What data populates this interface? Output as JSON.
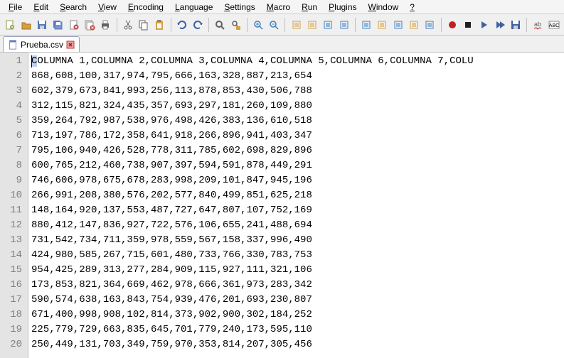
{
  "menu": {
    "items": [
      "File",
      "Edit",
      "Search",
      "View",
      "Encoding",
      "Language",
      "Settings",
      "Macro",
      "Run",
      "Plugins",
      "Window",
      "?"
    ]
  },
  "toolbar": {
    "items": [
      {
        "name": "new-file-icon",
        "color": "#8b9e4a"
      },
      {
        "name": "open-file-icon",
        "color": "#d8a040"
      },
      {
        "name": "save-icon",
        "color": "#5878c0"
      },
      {
        "name": "save-all-icon",
        "color": "#5878c0"
      },
      {
        "name": "close-icon",
        "color": "#c04040"
      },
      {
        "name": "close-all-icon",
        "color": "#c04040"
      },
      {
        "name": "print-icon",
        "color": "#606060"
      },
      {
        "sep": true
      },
      {
        "name": "cut-icon",
        "color": "#606060"
      },
      {
        "name": "copy-icon",
        "color": "#606060"
      },
      {
        "name": "paste-icon",
        "color": "#d8a040"
      },
      {
        "sep": true
      },
      {
        "name": "undo-icon",
        "color": "#4060a0"
      },
      {
        "name": "redo-icon",
        "color": "#4060a0"
      },
      {
        "sep": true
      },
      {
        "name": "find-icon",
        "color": "#606060"
      },
      {
        "name": "replace-icon",
        "color": "#d8a040"
      },
      {
        "sep": true
      },
      {
        "name": "zoom-in-icon",
        "color": "#4080c0"
      },
      {
        "name": "zoom-out-icon",
        "color": "#4080c0"
      },
      {
        "sep": true
      },
      {
        "name": "sync-v-icon",
        "color": "#d8a040"
      },
      {
        "name": "sync-h-icon",
        "color": "#d8a040"
      },
      {
        "name": "wrap-icon",
        "color": "#4080c0"
      },
      {
        "name": "chars-icon",
        "color": "#4080c0"
      },
      {
        "sep": true
      },
      {
        "name": "indent-icon",
        "color": "#4080c0"
      },
      {
        "name": "fold-icon",
        "color": "#d8a040"
      },
      {
        "name": "userlang-icon",
        "color": "#4080c0"
      },
      {
        "name": "docmap-icon",
        "color": "#d8a040"
      },
      {
        "name": "funclist-icon",
        "color": "#4080c0"
      },
      {
        "sep": true
      },
      {
        "name": "record-icon",
        "color": "#c02020"
      },
      {
        "name": "stop-icon",
        "color": "#202020"
      },
      {
        "name": "play-icon",
        "color": "#4060a0"
      },
      {
        "name": "playmulti-icon",
        "color": "#4060a0"
      },
      {
        "name": "savemacroicon",
        "color": "#4060a0"
      },
      {
        "sep": true
      },
      {
        "name": "spell-icon",
        "color": "#606060"
      },
      {
        "name": "abc-icon",
        "color": "#606060"
      }
    ]
  },
  "tab": {
    "filename": "Prueba.csv"
  },
  "editor": {
    "line_numbers": [
      "1",
      "2",
      "3",
      "4",
      "5",
      "6",
      "7",
      "8",
      "9",
      "10",
      "11",
      "12",
      "13",
      "14",
      "15",
      "16",
      "17",
      "18",
      "19",
      "20"
    ],
    "lines": [
      "COLUMNA 1,COLUMNA 2,COLUMNA 3,COLUMNA 4,COLUMNA 5,COLUMNA 6,COLUMNA 7,COLU",
      "868,608,100,317,974,795,666,163,328,887,213,654",
      "602,379,673,841,993,256,113,878,853,430,506,788",
      "312,115,821,324,435,357,693,297,181,260,109,880",
      "359,264,792,987,538,976,498,426,383,136,610,518",
      "713,197,786,172,358,641,918,266,896,941,403,347",
      "795,106,940,426,528,778,311,785,602,698,829,896",
      "600,765,212,460,738,907,397,594,591,878,449,291",
      "746,606,978,675,678,283,998,209,101,847,945,196",
      "266,991,208,380,576,202,577,840,499,851,625,218",
      "148,164,920,137,553,487,727,647,807,107,752,169",
      "880,412,147,836,927,722,576,106,655,241,488,694",
      "731,542,734,711,359,978,559,567,158,337,996,490",
      "424,980,585,267,715,601,480,733,766,330,783,753",
      "954,425,289,313,277,284,909,115,927,111,321,106",
      "173,853,821,364,669,462,978,666,361,973,283,342",
      "590,574,638,163,843,754,939,476,201,693,230,807",
      "671,400,998,908,102,814,373,902,900,302,184,252",
      "225,779,729,663,835,645,701,779,240,173,595,110",
      "250,449,131,703,349,759,970,353,814,207,305,456"
    ]
  }
}
